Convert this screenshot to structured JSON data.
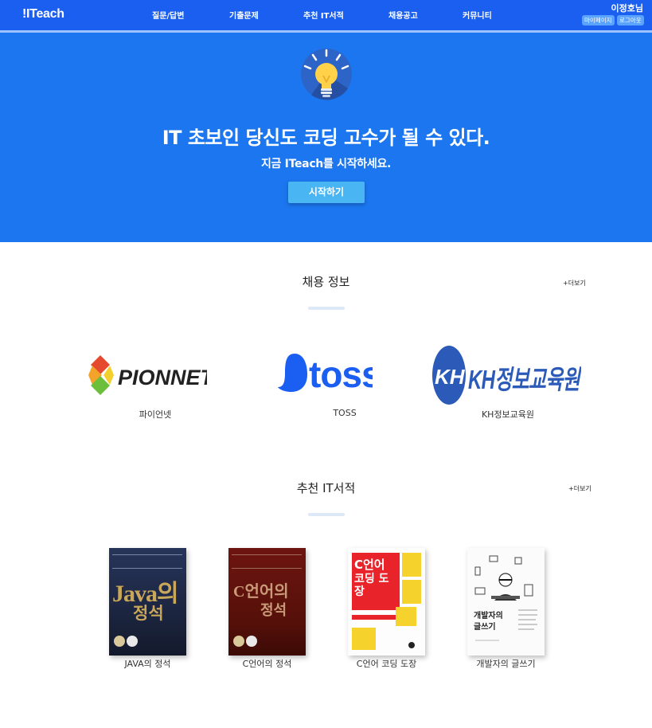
{
  "nav": {
    "brand": "!ITeach",
    "menu": [
      "질문/답변",
      "기출문제",
      "추천 IT서적",
      "채용공고",
      "커뮤니티"
    ],
    "user_name": "이정호님",
    "mypage": "마이페이지",
    "logout": "로그아웃"
  },
  "hero": {
    "title": "IT 초보인 당신도 코딩 고수가 될 수 있다.",
    "subtitle": "지금 ITeach를 시작하세요.",
    "button": "시작하기",
    "icon": "lightbulb-icon"
  },
  "jobs": {
    "title": "채용 정보",
    "more": "+더보기",
    "items": [
      {
        "name": "파이언넷",
        "logo_text": "PIONNET"
      },
      {
        "name": "TOSS",
        "logo_text": "toss"
      },
      {
        "name": "KH정보교육원",
        "logo_text": "KH정보교육원",
        "logo_mark": "KH"
      }
    ]
  },
  "books": {
    "title": "추천 IT서적",
    "more": "+더보기",
    "items": [
      {
        "name": "JAVA의 정석",
        "cover_main": "Java의",
        "cover_sub": "정석"
      },
      {
        "name": "C언어의 정석",
        "cover_main": "C언어의",
        "cover_sub": "정석"
      },
      {
        "name": "C언어 코딩 도장",
        "cover_main": "C언어",
        "cover_sub": "코딩 도장"
      },
      {
        "name": "개발자의 글쓰기",
        "cover_main": "개발자의",
        "cover_sub": "글쓰기"
      }
    ]
  },
  "colors": {
    "nav_bg": "#1a5ff0",
    "hero_bg": "#1b76ef",
    "button": "#49b6f3",
    "toss_blue": "#1a5ef2",
    "kh_blue": "#2b5ab8"
  }
}
